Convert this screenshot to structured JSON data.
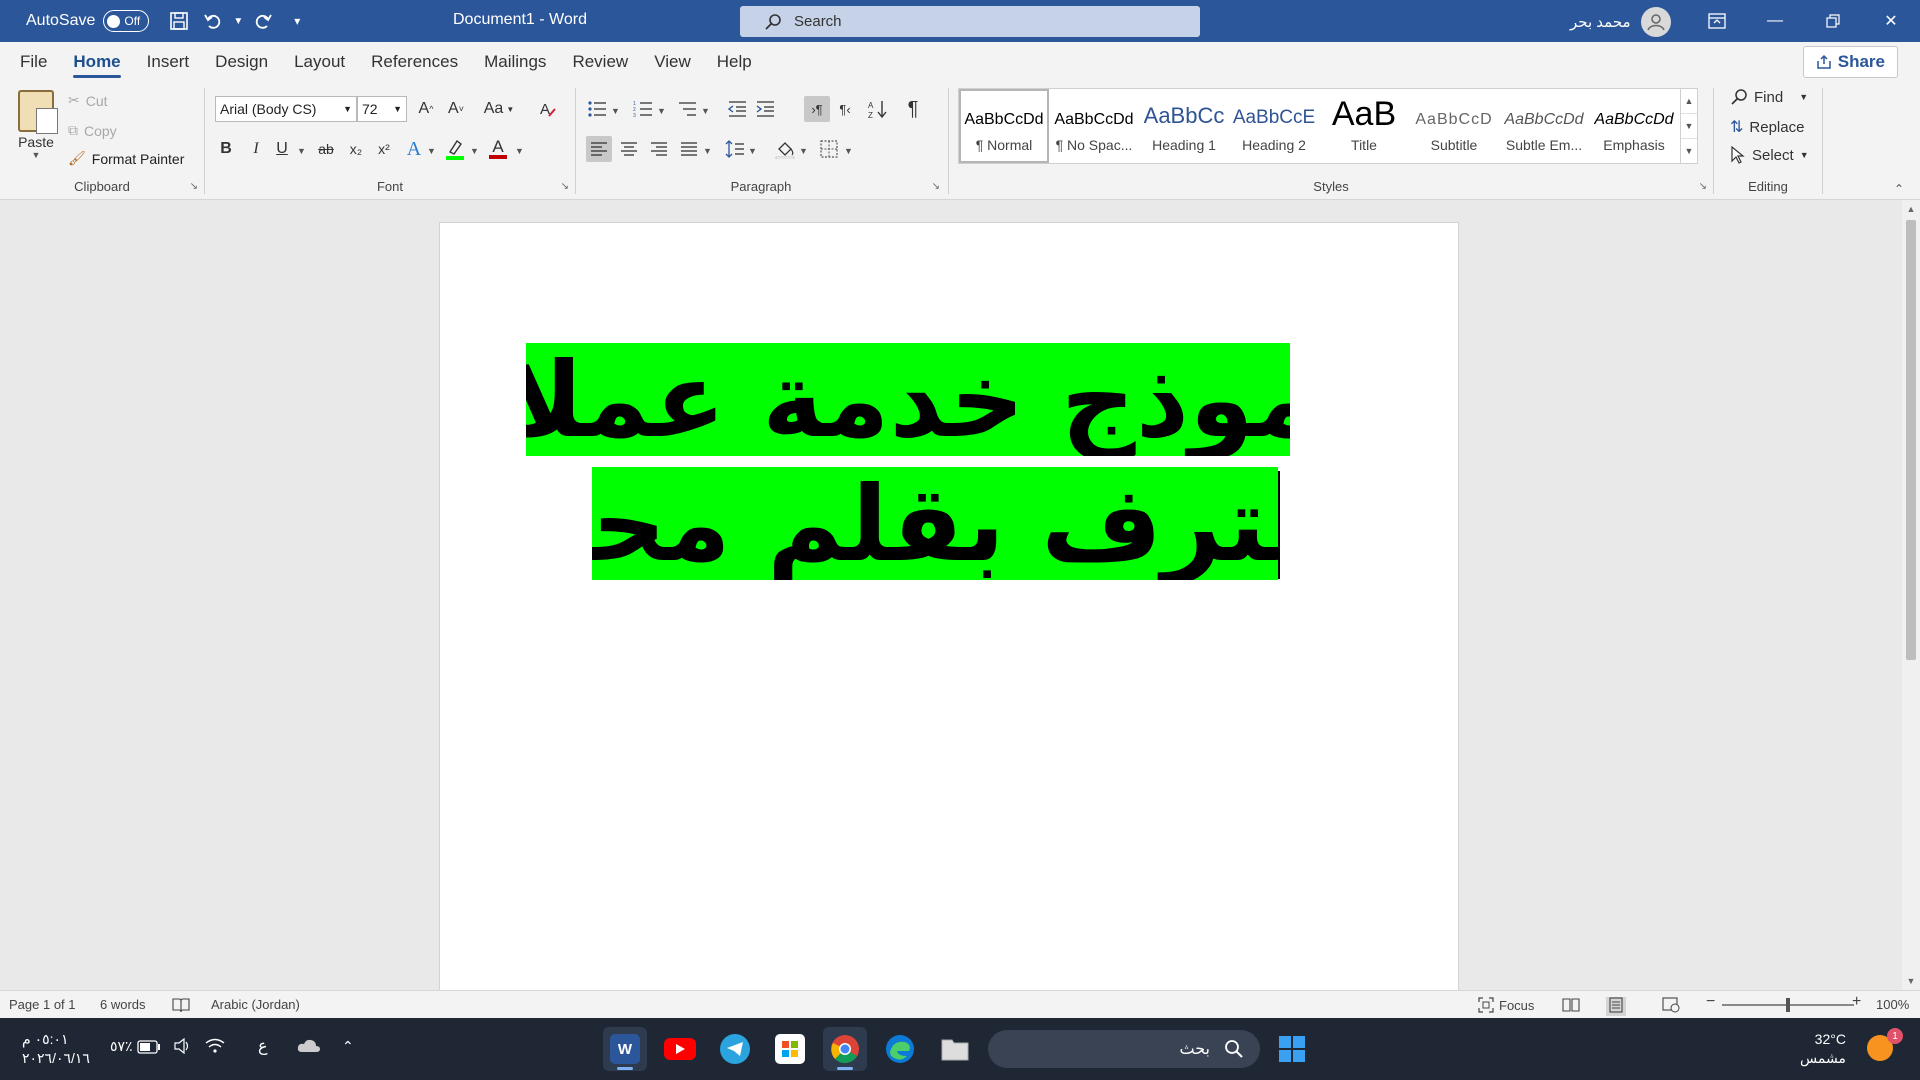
{
  "titlebar": {
    "autosave_label": "AutoSave",
    "autosave_state": "Off",
    "doc_title": "Document1  -  Word",
    "search_placeholder": "Search",
    "user_name": "محمد بحر",
    "accent_color": "#2b579a"
  },
  "menu": {
    "tabs": [
      "File",
      "Home",
      "Insert",
      "Design",
      "Layout",
      "References",
      "Mailings",
      "Review",
      "View",
      "Help"
    ],
    "active_tab": "Home",
    "share_label": "Share"
  },
  "ribbon": {
    "clipboard": {
      "label": "Clipboard",
      "paste": "Paste",
      "cut": "Cut",
      "copy": "Copy",
      "format_painter": "Format Painter"
    },
    "font": {
      "label": "Font",
      "font_name": "Arial (Body CS)",
      "font_size": "72",
      "grow_icon": "A^",
      "shrink_icon": "A˅",
      "case_icon": "Aa",
      "bold": "B",
      "italic": "I",
      "underline": "U",
      "strike": "ab",
      "subscript": "x₂",
      "superscript": "x²",
      "text_effects": "A",
      "font_color": "A",
      "highlight_color": "#00ff00",
      "font_color_value": "#c00000"
    },
    "paragraph": {
      "label": "Paragraph",
      "pilcrow": "¶"
    },
    "styles": {
      "label": "Styles",
      "items": [
        {
          "sample": "AaBbCcDd",
          "name": "¶ Normal"
        },
        {
          "sample": "AaBbCcDd",
          "name": "¶ No Spac..."
        },
        {
          "sample": "AaBbCc",
          "name": "Heading 1"
        },
        {
          "sample": "AaBbCcE",
          "name": "Heading 2"
        },
        {
          "sample": "AaB",
          "name": "Title"
        },
        {
          "sample": "AaBbCcD",
          "name": "Subtitle"
        },
        {
          "sample": "AaBbCcDd",
          "name": "Subtle Em..."
        },
        {
          "sample": "AaBbCcDd",
          "name": "Emphasis"
        }
      ]
    },
    "editing": {
      "label": "Editing",
      "find": "Find",
      "replace": "Replace",
      "select": "Select"
    }
  },
  "document": {
    "line1": "نموذج خدمة عملاء",
    "line2": "محترف بقلم محمد",
    "highlight": "#00ff00"
  },
  "status": {
    "page": "Page 1 of 1",
    "words": "6 words",
    "language": "Arabic (Jordan)",
    "focus": "Focus",
    "zoom": "100%",
    "zoom_fraction": 0.5
  },
  "taskbar": {
    "search_placeholder": "بحث",
    "battery": "٥٧٪",
    "input_lang": "ع",
    "time": "٠٥:٠١ م",
    "date": "٢٠٢٦/٠٦/١٦",
    "temperature": "32°C",
    "weather": "مشمس",
    "notifications": "1"
  }
}
